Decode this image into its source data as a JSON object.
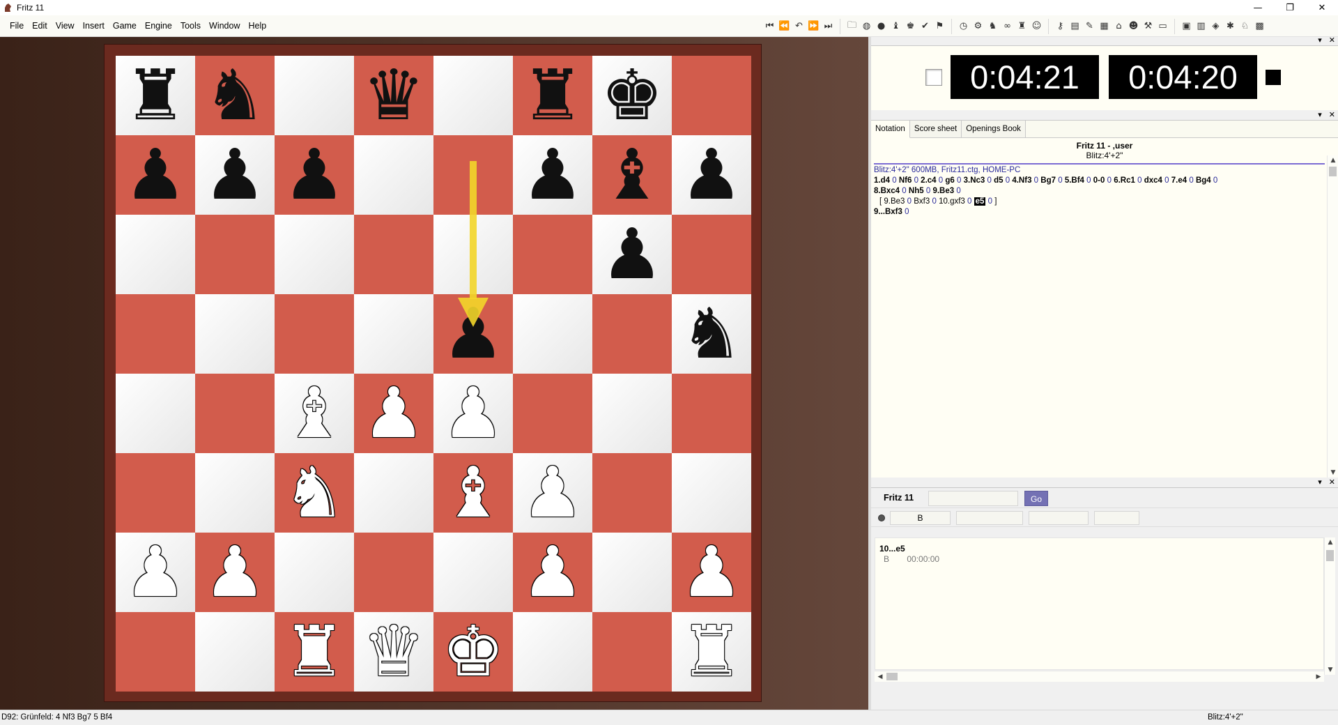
{
  "window": {
    "title": "Fritz 11",
    "minimize": "—",
    "maximize": "❐",
    "close": "✕"
  },
  "menu": [
    "File",
    "Edit",
    "View",
    "Insert",
    "Game",
    "Engine",
    "Tools",
    "Window",
    "Help"
  ],
  "toolbar": {
    "nav_icons": [
      "first-move-icon",
      "previous-move-icon",
      "take-back-icon",
      "next-move-icon",
      "last-move-icon"
    ],
    "game_icons": [
      "open-folder-icon",
      "globe-icon",
      "coin-icon",
      "chess-figures-icon",
      "king-icon",
      "green-check-icon",
      "flag-icon"
    ],
    "engine_icons": [
      "clock-icon",
      "engine-icon",
      "knight-hand-icon",
      "infinite-analysis-icon",
      "pieces-icon",
      "coach-icon"
    ],
    "tools_icons": [
      "key-icon",
      "book-icon",
      "chart-icon",
      "board-icon",
      "explorer-icon",
      "user-icon",
      "settings-icon",
      "window-icon"
    ],
    "view_icons": [
      "save-icon",
      "database-icon",
      "cube-icon",
      "network-icon",
      "pieces-setup-icon",
      "board-3d-icon"
    ]
  },
  "board": {
    "colors": {
      "light": "#ffffff",
      "dark": "#d25c4c",
      "arrow": "#f3d62a"
    },
    "pieces": [
      {
        "sq": "a8",
        "piece": "r",
        "color": "black"
      },
      {
        "sq": "b8",
        "piece": "n",
        "color": "black"
      },
      {
        "sq": "d8",
        "piece": "q",
        "color": "black"
      },
      {
        "sq": "f8",
        "piece": "r",
        "color": "black"
      },
      {
        "sq": "g8",
        "piece": "k",
        "color": "black"
      },
      {
        "sq": "a7",
        "piece": "p",
        "color": "black"
      },
      {
        "sq": "b7",
        "piece": "p",
        "color": "black"
      },
      {
        "sq": "c7",
        "piece": "p",
        "color": "black"
      },
      {
        "sq": "f7",
        "piece": "p",
        "color": "black"
      },
      {
        "sq": "g7",
        "piece": "b",
        "color": "black"
      },
      {
        "sq": "h7",
        "piece": "p",
        "color": "black"
      },
      {
        "sq": "g6",
        "piece": "p",
        "color": "black"
      },
      {
        "sq": "e5",
        "piece": "p",
        "color": "black"
      },
      {
        "sq": "h5",
        "piece": "n",
        "color": "black"
      },
      {
        "sq": "c4",
        "piece": "b",
        "color": "white"
      },
      {
        "sq": "d4",
        "piece": "p",
        "color": "white"
      },
      {
        "sq": "e4",
        "piece": "p",
        "color": "white"
      },
      {
        "sq": "c3",
        "piece": "n",
        "color": "white"
      },
      {
        "sq": "e3",
        "piece": "b",
        "color": "white"
      },
      {
        "sq": "f3",
        "piece": "p",
        "color": "white"
      },
      {
        "sq": "a2",
        "piece": "p",
        "color": "white"
      },
      {
        "sq": "b2",
        "piece": "p",
        "color": "white"
      },
      {
        "sq": "f2",
        "piece": "p",
        "color": "white"
      },
      {
        "sq": "h2",
        "piece": "p",
        "color": "white"
      },
      {
        "sq": "c1",
        "piece": "r",
        "color": "white"
      },
      {
        "sq": "d1",
        "piece": "q",
        "color": "white"
      },
      {
        "sq": "e1",
        "piece": "k",
        "color": "white"
      },
      {
        "sq": "h1",
        "piece": "r",
        "color": "white"
      }
    ],
    "last_move": {
      "from": "e7",
      "to": "e5"
    }
  },
  "clocks": {
    "white": "0:04:21",
    "black": "0:04:20"
  },
  "notation": {
    "tabs": [
      "Notation",
      "Score sheet",
      "Openings Book"
    ],
    "header_title": "Fritz 11 - ,user",
    "header_sub": "Blitz:4'+2\"",
    "info_line": "Blitz:4'+2\"  600MB, Fritz11.ctg, HOME-PC",
    "main_moves": [
      {
        "m": "1.d4",
        "c": "0"
      },
      {
        "m": "Nf6",
        "c": "0"
      },
      {
        "m": "2.c4",
        "c": "0"
      },
      {
        "m": "g6",
        "c": "0"
      },
      {
        "m": "3.Nc3",
        "c": "0"
      },
      {
        "m": "d5",
        "c": "0"
      },
      {
        "m": "4.Nf3",
        "c": "0"
      },
      {
        "m": "Bg7",
        "c": "0"
      },
      {
        "m": "5.Bf4",
        "c": "0"
      },
      {
        "m": "0-0",
        "c": "0"
      },
      {
        "m": "6.Rc1",
        "c": "0"
      },
      {
        "m": "dxc4",
        "c": "0"
      },
      {
        "m": "7.e4",
        "c": "0"
      },
      {
        "m": "Bg4",
        "c": "0"
      }
    ],
    "main_moves_2": [
      {
        "m": "8.Bxc4",
        "c": "0"
      },
      {
        "m": "Nh5",
        "c": "0"
      },
      {
        "m": "9.Be3",
        "c": "0"
      }
    ],
    "variation_open": "[",
    "variation": [
      {
        "m": "9.Be3",
        "c": "0"
      },
      {
        "m": "Bxf3",
        "c": "0"
      },
      {
        "m": "10.gxf3",
        "c": "0"
      }
    ],
    "current_move": "e5",
    "current_clock": "0",
    "variation_close": "]",
    "after_line": [
      {
        "m": "9...Bxf3",
        "c": "0"
      }
    ]
  },
  "engine": {
    "name": "Fritz 11",
    "go_label": "Go",
    "side_label": "B",
    "move": "10...e5",
    "line_side": "B",
    "line_time": "00:00:00"
  },
  "status": {
    "opening": "D92: Grünfeld: 4 Nf3 Bg7 5 Bf4",
    "time_control": "Blitz:4'+2\""
  }
}
